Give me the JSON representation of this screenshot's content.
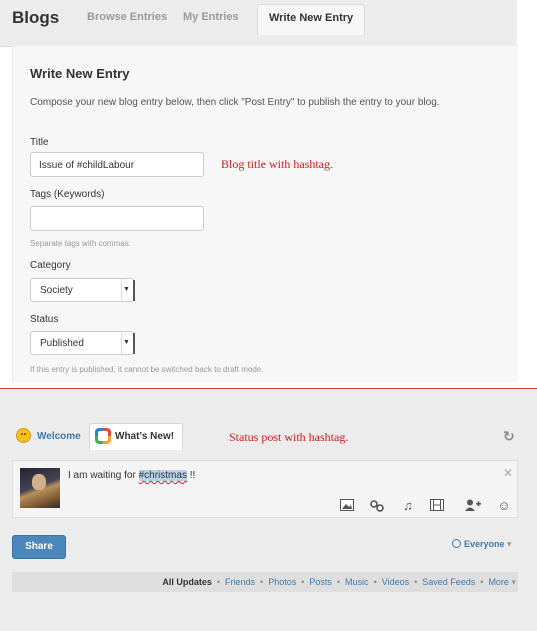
{
  "blogs": {
    "brand": "Blogs",
    "tabs": [
      {
        "label": "Browse Entries"
      },
      {
        "label": "My Entries"
      },
      {
        "label": "Write New Entry"
      }
    ],
    "form": {
      "heading": "Write New Entry",
      "description": "Compose your new blog entry below, then click \"Post Entry\" to publish the entry to your blog.",
      "title_label": "Title",
      "title_value": "Issue of #childLabour",
      "tags_label": "Tags (Keywords)",
      "tags_value": "",
      "tags_hint": "Separate tags with commas.",
      "category_label": "Category",
      "category_value": "Society",
      "status_label": "Status",
      "status_value": "Published",
      "status_hint": "If this entry is published, it cannot be switched back to draft mode."
    },
    "annotation": "Blog title with hashtag."
  },
  "status_panel": {
    "tabs": [
      {
        "label": "Welcome"
      },
      {
        "label": "What's New!"
      }
    ],
    "annotation": "Status post with hashtag.",
    "post_text_before": "I am waiting for ",
    "post_hashtag": "#christmas",
    "post_text_after": " !!",
    "icons": [
      "photo-icon",
      "link-icon",
      "music-icon",
      "video-icon",
      "add-user-icon",
      "emoticon-icon"
    ],
    "share_label": "Share",
    "privacy_label": "Everyone",
    "filters": [
      "All Updates",
      "Friends",
      "Photos",
      "Posts",
      "Music",
      "Videos",
      "Saved Feeds",
      "More"
    ]
  },
  "colors": {
    "annotation": "#d21a1a",
    "link": "#3d7ab0",
    "share_button": "#4a87bd",
    "divider": "#d63b3b"
  }
}
